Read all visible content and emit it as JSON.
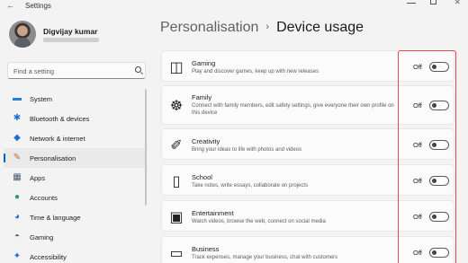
{
  "window": {
    "title": "Settings",
    "back_glyph": "←",
    "close_glyph": "✕"
  },
  "user": {
    "name": "Digvijay kumar"
  },
  "search": {
    "placeholder": "Find a setting"
  },
  "sidebar": {
    "items": [
      {
        "label": "System",
        "icon": "system-icon",
        "glyph": "▬",
        "color": "#2b7cd3"
      },
      {
        "label": "Bluetooth & devices",
        "icon": "bluetooth-icon",
        "glyph": "✱",
        "color": "#1f6fd1"
      },
      {
        "label": "Network & internet",
        "icon": "wifi-icon",
        "glyph": "◆",
        "color": "#1d6dd4"
      },
      {
        "label": "Personalisation",
        "icon": "pencil-icon",
        "glyph": "✎",
        "color": "#c46a2a",
        "active": true
      },
      {
        "label": "Apps",
        "icon": "apps-icon",
        "glyph": "▦",
        "color": "#4a5a7a"
      },
      {
        "label": "Accounts",
        "icon": "accounts-icon",
        "glyph": "●",
        "color": "#2e9e5b"
      },
      {
        "label": "Time & language",
        "icon": "globe-icon",
        "glyph": "◕",
        "color": "#1f7ad6"
      },
      {
        "label": "Gaming",
        "icon": "gamepad-icon",
        "glyph": "◓",
        "color": "#6a6a6a"
      },
      {
        "label": "Accessibility",
        "icon": "accessibility-icon",
        "glyph": "✦",
        "color": "#1a73c8"
      }
    ]
  },
  "header": {
    "parent": "Personalisation",
    "separator": "›",
    "current": "Device usage"
  },
  "cards": [
    {
      "title": "Gaming",
      "desc": "Play and discover games, keep up with new releases",
      "icon": "gamepad-icon",
      "glyph": "◫",
      "state": "Off"
    },
    {
      "title": "Family",
      "desc": "Connect with family members, edit safety settings, give everyone their own profile on this device",
      "icon": "family-icon",
      "glyph": "☸",
      "state": "Off"
    },
    {
      "title": "Creativity",
      "desc": "Bring your ideas to life with photos and videos",
      "icon": "creativity-icon",
      "glyph": "✐",
      "state": "Off"
    },
    {
      "title": "School",
      "desc": "Take notes, write essays, collaborate on projects",
      "icon": "notebook-icon",
      "glyph": "▯",
      "state": "Off"
    },
    {
      "title": "Entertainment",
      "desc": "Watch videos, browse the web, connect on social media",
      "icon": "entertainment-icon",
      "glyph": "▣",
      "state": "Off"
    },
    {
      "title": "Business",
      "desc": "Track expenses, manage your business, chat with customers",
      "icon": "briefcase-icon",
      "glyph": "▭",
      "state": "Off"
    }
  ],
  "colors": {
    "accent": "#005fb8",
    "highlight_box": "#e5484d"
  }
}
